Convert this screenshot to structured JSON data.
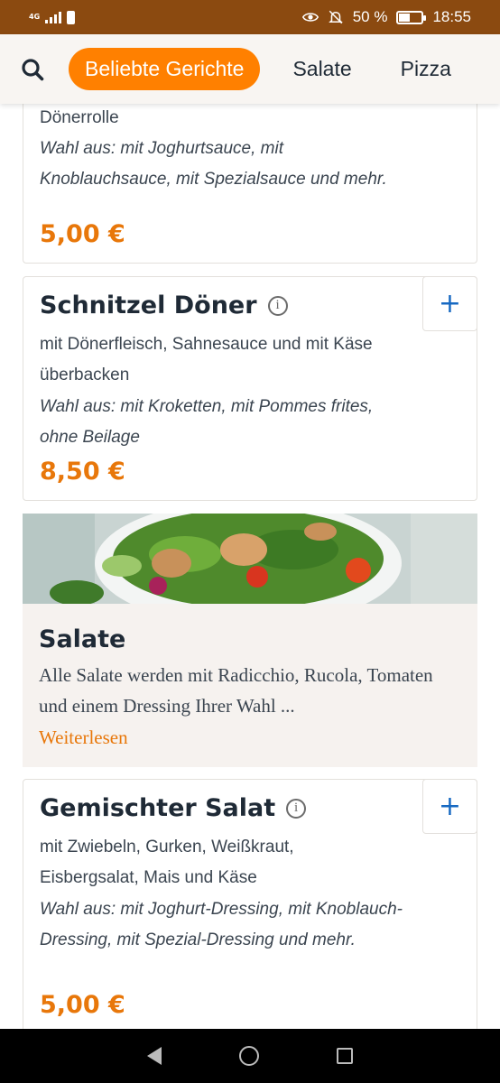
{
  "status_bar": {
    "network": "4G",
    "battery_percent": "50 %",
    "time": "18:55",
    "icons": [
      "signal-icon",
      "battery-small-icon",
      "eye-icon",
      "bell-off-icon",
      "battery-icon"
    ]
  },
  "nav": {
    "search_icon": "search-icon",
    "categories": [
      "Beliebte Gerichte",
      "Salate",
      "Pizza"
    ],
    "active_category": "Beliebte Gerichte"
  },
  "items": [
    {
      "name": "",
      "desc": "Dönerrolle",
      "choice": "Wahl aus: mit Joghurtsauce, mit Knoblauchsauce, mit Spezialsauce und mehr.",
      "price": "5,00 €"
    },
    {
      "name": "Schnitzel Döner",
      "desc": "mit Dönerfleisch, Sahnesauce und mit Käse überbacken",
      "choice": "Wahl aus: mit Kroketten, mit Pommes frites, ohne Beilage",
      "price": "8,50 €"
    },
    {
      "name": "Gemischter Salat",
      "desc": "mit Zwiebeln, Gurken, Weißkraut, Eisbergsalat, Mais und Käse",
      "choice": "Wahl aus: mit Joghurt-Dressing, mit Knoblauch-Dressing, mit Spezial-Dressing und mehr.",
      "price": "5,00 €"
    }
  ],
  "category_section": {
    "title": "Salate",
    "description": "Alle Salate werden mit Radicchio, Rucola, Tomaten und einem Dressing Ihrer Wahl ...",
    "read_more": "Weiterlesen"
  },
  "add_label": "+",
  "info_label": "i",
  "colors": {
    "status_bar": "#8b4a10",
    "accent": "#ff8000",
    "price": "#e8770a",
    "add_button": "#1769c2",
    "text": "#1f2a36"
  }
}
